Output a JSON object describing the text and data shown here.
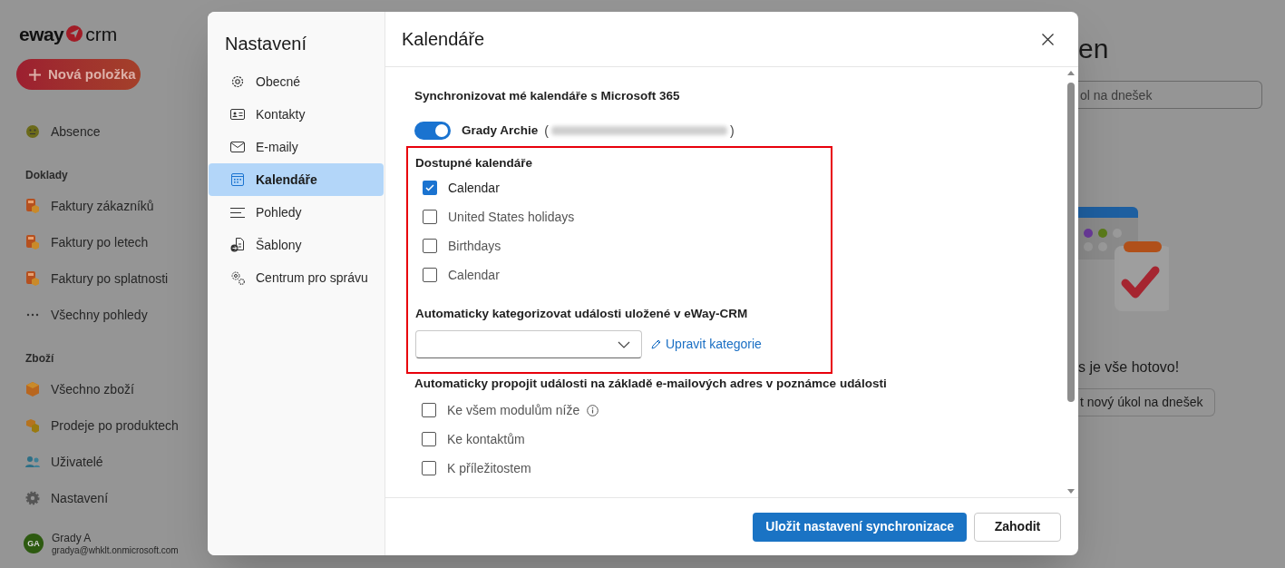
{
  "app": {
    "logo": {
      "brand": "eway",
      "suffix": "crm"
    },
    "new_button": "Nová položka",
    "sidebar": [
      {
        "kind": "item",
        "label": "Absence"
      },
      {
        "kind": "header",
        "label": "Doklady"
      },
      {
        "kind": "item",
        "label": "Faktury zákazníků"
      },
      {
        "kind": "item",
        "label": "Faktury po letech"
      },
      {
        "kind": "item",
        "label": "Faktury po splatnosti"
      },
      {
        "kind": "item",
        "label": "Všechny pohledy"
      },
      {
        "kind": "header",
        "label": "Zboží"
      },
      {
        "kind": "item",
        "label": "Všechno zboží"
      },
      {
        "kind": "item",
        "label": "Prodeje po produktech"
      },
      {
        "kind": "item",
        "label": "Uživatelé"
      },
      {
        "kind": "item",
        "label": "Nastavení"
      }
    ],
    "user": {
      "initials": "GA",
      "name": "Grady A",
      "email": "gradya@whklt.onmicrosoft.com"
    }
  },
  "background_page": {
    "title": "en",
    "search_placeholder": "ol na dnešek",
    "empty_message": "s je vše hotovo!",
    "button": "t nový úkol na dnešek"
  },
  "dialog": {
    "nav_title": "Nastavení",
    "nav": [
      {
        "label": "Obecné",
        "selected": false
      },
      {
        "label": "Kontakty",
        "selected": false
      },
      {
        "label": "E-maily",
        "selected": false
      },
      {
        "label": "Kalendáře",
        "selected": true
      },
      {
        "label": "Pohledy",
        "selected": false
      },
      {
        "label": "Šablony",
        "selected": false
      },
      {
        "label": "Centrum pro správu",
        "selected": false
      }
    ],
    "title": "Kalendáře",
    "sync_heading": "Synchronizovat mé kalendáře s Microsoft 365",
    "account": {
      "on": true,
      "name": "Grady Archie",
      "open_paren": "(",
      "close_paren": ")"
    },
    "highlighted": true,
    "calendars_heading": "Dostupné kalendáře",
    "calendars": [
      {
        "label": "Calendar",
        "checked": true
      },
      {
        "label": "United States holidays",
        "checked": false
      },
      {
        "label": "Birthdays",
        "checked": false
      },
      {
        "label": "Calendar",
        "checked": false
      }
    ],
    "category_heading": "Automaticky kategorizovat události uložené v eWay-CRM",
    "edit_categories": "Upravit kategorie",
    "link_heading": "Automaticky propojit události na základě e-mailových adres v poznámce události",
    "link_options": [
      {
        "label": "Ke všem modulům níže",
        "checked": false,
        "info": true
      },
      {
        "label": "Ke kontaktům",
        "checked": false,
        "info": false
      },
      {
        "label": "K příležitostem",
        "checked": false,
        "info": false
      }
    ],
    "save_button": "Uložit nastavení synchronizace",
    "discard_button": "Zahodit"
  }
}
